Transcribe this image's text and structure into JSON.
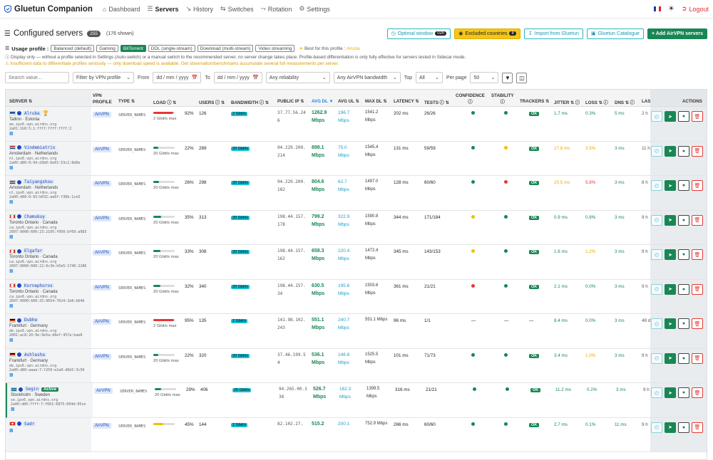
{
  "nav": {
    "brand": "Gluetun Companion",
    "links": [
      {
        "label": "Dashboard",
        "icon": "dashboard-icon",
        "glyph": "⌂",
        "active": false
      },
      {
        "label": "Servers",
        "icon": "servers-icon",
        "glyph": "☰",
        "active": true
      },
      {
        "label": "History",
        "icon": "history-icon",
        "glyph": "↘",
        "active": false
      },
      {
        "label": "Switches",
        "icon": "switches-icon",
        "glyph": "⇆",
        "active": false
      },
      {
        "label": "Rotation",
        "icon": "rotation-icon",
        "glyph": "⤳",
        "active": false
      },
      {
        "label": "Settings",
        "icon": "settings-icon",
        "glyph": "⚙",
        "active": false
      }
    ],
    "logout": "Logout"
  },
  "header": {
    "title": "Configured servers",
    "count": "255",
    "shown": "(176 shown)",
    "optimal_window": "Optimal window",
    "optimal_window_tag": "02h",
    "excluded_countries": "Excluded countries",
    "excluded_count": "8",
    "import": "Import from Gluetun",
    "catalogue": "Gluetun Catalogue",
    "add": "+ Add AirVPN servers"
  },
  "profile": {
    "label": "Usage profile :",
    "options": [
      "Balanced (default)",
      "Gaming",
      "BitTorrent",
      "DDL (single-stream)",
      "Download (multi-stream)",
      "Video streaming"
    ],
    "active_index": 2,
    "best_for": "Best for this profile :",
    "best_for_value": "Alruba"
  },
  "info": {
    "line1": "ⓘ Display only — without a profile selected in Settings (Auto-switch) or a manual switch to the recommended server, no server change takes place. Profile-based differentiation is only fully effective for servers tested in Sidecar mode.",
    "line2": "⚠ Insufficient data to differentiate profiles seriously — only download speed is available. Get observation/benchmarks accumulate several full measurements per server."
  },
  "filters": {
    "search_placeholder": "Search value...",
    "vpn_profile": "Filter by VPN profile",
    "from": "From",
    "to": "To",
    "date_placeholder": "dd / mm / yyyy",
    "reliability": "Any reliability",
    "bandwidth": "Any AirVPN bandwidth",
    "top": "Top",
    "top_value": "All",
    "per_page": "Per page",
    "per_page_value": "50"
  },
  "columns": {
    "server": "SERVER ⇅",
    "vpn1": "VPN",
    "vpn2": "PROFILE",
    "type": "TYPE ⇅",
    "load": "LOAD ⓘ ⇅",
    "users": "USERS ⓘ ⇅",
    "bandwidth": "BANDWIDTH ⓘ ⇅",
    "ip": "PUBLIC IP ⇅",
    "avgdl": "AVG DL ▼",
    "avgul": "AVG UL ⇅",
    "maxdl": "MAX DL ⇅",
    "latency": "LATENCY ⇅",
    "tests": "TESTS ⓘ ⇅",
    "confidence1": "CONFIDENCE",
    "confidence2": "ⓘ",
    "stability1": "STABILITY",
    "stability2": "ⓘ",
    "trackers": "TRACKERS ⇅",
    "jitter": "JITTER ⇅ ⓘ",
    "loss": "LOSS ⇅ ⓘ",
    "dns": "DNS ⇅ ⓘ",
    "last": "LAS",
    "actions": "ACTIONS"
  },
  "rows": [
    {
      "flag": "ee",
      "name": "Alruba",
      "star": "🏆",
      "active": "",
      "loc": "Tallinn · Estonia",
      "host": "ee.ipv6.vpn.airdns.org",
      "ipv6": "2a01:1b0:5:1:ffff:ffff:ffff:2",
      "vpn": "AirVPN",
      "stype": "SERVER_NAMES",
      "load": 92,
      "load_pct": "92%",
      "load_color": "#e53935",
      "users": "126",
      "gbit": "2 Gbit/s max",
      "bw": "2 Gbit/s",
      "ip1": "37.77.56.24",
      "ip2": "6",
      "dl1": "1262.9",
      "dl2": "Mbps",
      "ul1": "196.7",
      "ul2": "Mbps",
      "max1": "1541.2",
      "max2": "Mbps",
      "lat": "202 ms",
      "tests": "26/26",
      "conf": "#198754",
      "stab": "#198754",
      "trackers": "OK",
      "jitter": "1.7 ms",
      "jitter_c": "gtext",
      "loss": "0.3%",
      "loss_c": "gtext",
      "dns": "5 ms",
      "last": "2 h"
    },
    {
      "flag": "nl",
      "name": "Vindemiatrix",
      "star": "",
      "active": "",
      "loc": "Amsterdam · Netherlands",
      "host": "nl.ipv6.vpn.airdns.org",
      "ipv6": "2a00:d80:0:94:d3b0:6e01:53c2:8d0e",
      "vpn": "AirVPN",
      "stype": "SERVER_NAMES",
      "load": 22,
      "load_pct": "22%",
      "load_color": "#198754",
      "users": "289",
      "gbit": "20 Gbit/s max",
      "bw": "20 Gbit/s",
      "ip1": "94.229.200.",
      "ip2": "214",
      "dl1": "898.1",
      "dl2": "Mbps",
      "ul1": "75.0",
      "ul2": "Mbps",
      "max1": "1545.4",
      "max2": "Mbps",
      "lat": "131 ms",
      "tests": "59/59",
      "conf": "#198754",
      "stab": "#f0c000",
      "trackers": "OK",
      "jitter": "17.8 ms",
      "jitter_c": "otext",
      "loss": "3.5%",
      "loss_c": "otext",
      "dns": "3 ms",
      "last": "11 h"
    },
    {
      "flag": "nl",
      "name": "Taiyangshou",
      "star": "",
      "active": "",
      "loc": "Amsterdam · Netherlands",
      "host": "nl.ipv6.vpn.airdns.org",
      "ipv6": "2a00:d80:0:93:b032:ae6f:f30b:1ce5",
      "vpn": "AirVPN",
      "stype": "SERVER_NAMES",
      "load": 26,
      "load_pct": "26%",
      "load_color": "#198754",
      "users": "298",
      "gbit": "20 Gbit/s max",
      "bw": "20 Gbit/s",
      "ip1": "94.229.200.",
      "ip2": "182",
      "dl1": "804.6",
      "dl2": "Mbps",
      "ul1": "62.7",
      "ul2": "Mbps",
      "max1": "1497.0",
      "max2": "Mbps",
      "lat": "128 ms",
      "tests": "60/60",
      "conf": "#198754",
      "stab": "#e53935",
      "trackers": "OK",
      "jitter": "20.5 ms",
      "jitter_c": "otext",
      "loss": "5.8%",
      "loss_c": "rtext",
      "dns": "3 ms",
      "last": "8 h"
    },
    {
      "flag": "ca",
      "name": "Chamukuy",
      "star": "",
      "active": "",
      "loc": "Toronto Ontario · Canada",
      "host": "ca.ipv6.vpn.airdns.org",
      "ipv6": "2607:9000:600:23:2105:f050:bf69:a983",
      "vpn": "AirVPN",
      "stype": "SERVER_NAMES",
      "load": 35,
      "load_pct": "35%",
      "load_color": "#198754",
      "users": "313",
      "gbit": "20 Gbit/s max",
      "bw": "20 Gbit/s",
      "ip1": "198.44.157.",
      "ip2": "178",
      "dl1": "799.2",
      "dl2": "Mbps",
      "ul1": "322.9",
      "ul2": "Mbps",
      "max1": "1590.8",
      "max2": "Mbps",
      "lat": "344 ms",
      "tests": "171/184",
      "conf": "#f0c000",
      "stab": "#198754",
      "trackers": "OK",
      "jitter": "0.9 ms",
      "jitter_c": "gtext",
      "loss": "0.8%",
      "loss_c": "gtext",
      "dns": "3 ms",
      "last": "9 h"
    },
    {
      "flag": "ca",
      "name": "Elgafar",
      "star": "",
      "active": "",
      "loc": "Toronto Ontario · Canada",
      "host": "ca.ipv6.vpn.airdns.org",
      "ipv6": "2607:9000:600:22:0c3b:b5e5:1740:2286",
      "vpn": "AirVPN",
      "stype": "SERVER_NAMES",
      "load": 33,
      "load_pct": "33%",
      "load_color": "#198754",
      "users": "308",
      "gbit": "20 Gbit/s max",
      "bw": "20 Gbit/s",
      "ip1": "198.44.157.",
      "ip2": "162",
      "dl1": "658.3",
      "dl2": "Mbps",
      "ul1": "220.4",
      "ul2": "Mbps",
      "max1": "1472.4",
      "max2": "Mbps",
      "lat": "345 ms",
      "tests": "143/153",
      "conf": "#f0c000",
      "stab": "#198754",
      "trackers": "OK",
      "jitter": "1.6 ms",
      "jitter_c": "gtext",
      "loss": "1.2%",
      "loss_c": "otext",
      "dns": "3 ms",
      "last": "9 h"
    },
    {
      "flag": "ca",
      "name": "Kornephoros",
      "star": "",
      "active": "",
      "loc": "Toronto Ontario · Canada",
      "host": "ca.ipv6.vpn.airdns.org",
      "ipv6": "2607:9000:600:25:0654:7624:1b8:b646",
      "vpn": "AirVPN",
      "stype": "SERVER_NAMES",
      "load": 32,
      "load_pct": "32%",
      "load_color": "#198754",
      "users": "340",
      "gbit": "20 Gbit/s max",
      "bw": "20 Gbit/s",
      "ip1": "198.44.157.",
      "ip2": "34",
      "dl1": "630.5",
      "dl2": "Mbps",
      "ul1": "195.6",
      "ul2": "Mbps",
      "max1": "1503.6",
      "max2": "Mbps",
      "lat": "361 ms",
      "tests": "21/21",
      "conf": "#e53935",
      "stab": "#198754",
      "trackers": "OK",
      "jitter": "2.1 ms",
      "jitter_c": "gtext",
      "loss": "0.0%",
      "loss_c": "gtext",
      "dns": "3 ms",
      "last": "9 h"
    },
    {
      "flag": "de",
      "name": "Dubhe",
      "star": "",
      "active": "",
      "loc": "Frankfurt · Germany",
      "host": "de.ipv6.vpn.airdns.org",
      "ipv6": "2001:ac8:20:9e:9e5a:d6ef:457a:bae8",
      "vpn": "AirVPN",
      "stype": "SERVER_NAMES",
      "load": 95,
      "load_pct": "95%",
      "load_color": "#e53935",
      "users": "135",
      "gbit": "2 Gbit/s max",
      "bw": "2 Gbit/s",
      "ip1": "141.98.102.",
      "ip2": "243",
      "dl1": "551.1",
      "dl2": "Mbps",
      "ul1": "240.7",
      "ul2": "Mbps",
      "max1": "551.1 Mbps",
      "max2": "",
      "lat": "96 ms",
      "tests": "1/1",
      "conf": "",
      "stab": "",
      "conf_text": "—",
      "stab_text": "—",
      "trackers": "—",
      "jitter": "8.4 ms",
      "jitter_c": "gtext",
      "loss": "0.0%",
      "loss_c": "gtext",
      "dns": "3 ms",
      "last": "48 d"
    },
    {
      "flag": "de",
      "name": "Ashlesha",
      "star": "",
      "active": "",
      "loc": "Frankfurt · Germany",
      "host": "de.ipv6.vpn.airdns.org",
      "ipv6": "2a00:d80:aaaa:7:f250:e2a0:d6b5:3c50",
      "vpn": "AirVPN",
      "stype": "SERVER_NAMES",
      "load": 22,
      "load_pct": "22%",
      "load_color": "#198754",
      "users": "320",
      "gbit": "20 Gbit/s max",
      "bw": "20 Gbit/s",
      "ip1": "37.46.199.5",
      "ip2": "4",
      "dl1": "536.1",
      "dl2": "Mbps",
      "ul1": "148.8",
      "ul2": "Mbps",
      "max1": "1525.5",
      "max2": "Mbps",
      "lat": "101 ms",
      "tests": "71/73",
      "conf": "#198754",
      "stab": "#198754",
      "trackers": "OK",
      "jitter": "3.4 ms",
      "jitter_c": "gtext",
      "loss": "1.0%",
      "loss_c": "otext",
      "dns": "3 ms",
      "last": "9 h"
    },
    {
      "flag": "se",
      "name": "Segin",
      "star": "",
      "active": "Active",
      "loc": "Stockholm · Sweden",
      "host": "se.ipv6.vpn.airdns.org",
      "ipv6": "2a00:d80:ffff:7:f601:6875:604d:05ce",
      "vpn": "AirVPN",
      "stype": "SERVER_NAMES",
      "load": 29,
      "load_pct": "29%",
      "load_color": "#198754",
      "users": "406",
      "gbit": "20 Gbit/s max",
      "bw": "20 Gbit/s",
      "ip1": "94.265.00.3",
      "ip2": "38",
      "dl1": "526.7",
      "dl2": "Mbps",
      "ul1": "162.3",
      "ul2": "Mbps",
      "max1": "1399.5",
      "max2": "Mbps",
      "lat": "316 ms",
      "tests": "21/21",
      "conf": "#198754",
      "stab": "#198754",
      "trackers": "OK",
      "jitter": "11.2 ms",
      "jitter_c": "gtext",
      "loss": "0.2%",
      "loss_c": "gtext",
      "dns": "3 ms",
      "last": "9 h"
    },
    {
      "flag": "ch",
      "name": "Sadr",
      "star": "",
      "active": "",
      "loc": "",
      "host": "",
      "ipv6": "",
      "vpn": "AirVPN",
      "stype": "SERVER_NAMES",
      "load": 45,
      "load_pct": "45%",
      "load_color": "#f0c000",
      "users": "144",
      "gbit": "",
      "bw": "2 Gbit/s",
      "ip1": "82.102.27.",
      "ip2": "",
      "dl1": "515.2",
      "dl2": "",
      "ul1": "200.1",
      "ul2": "",
      "max1": "752.9 Mbps",
      "max2": "",
      "lat": "266 ms",
      "tests": "60/60",
      "conf": "#198754",
      "stab": "#198754",
      "trackers": "OK",
      "jitter": "2.7 ms",
      "jitter_c": "gtext",
      "loss": "0.1%",
      "loss_c": "gtext",
      "dns": "11 ms",
      "last": "9 h"
    }
  ],
  "colors": {
    "accent": "#198754",
    "brand_blue": "#1a4cbf",
    "warning": "#f5c518",
    "danger": "#e53935",
    "cyan": "#17c1d6"
  }
}
